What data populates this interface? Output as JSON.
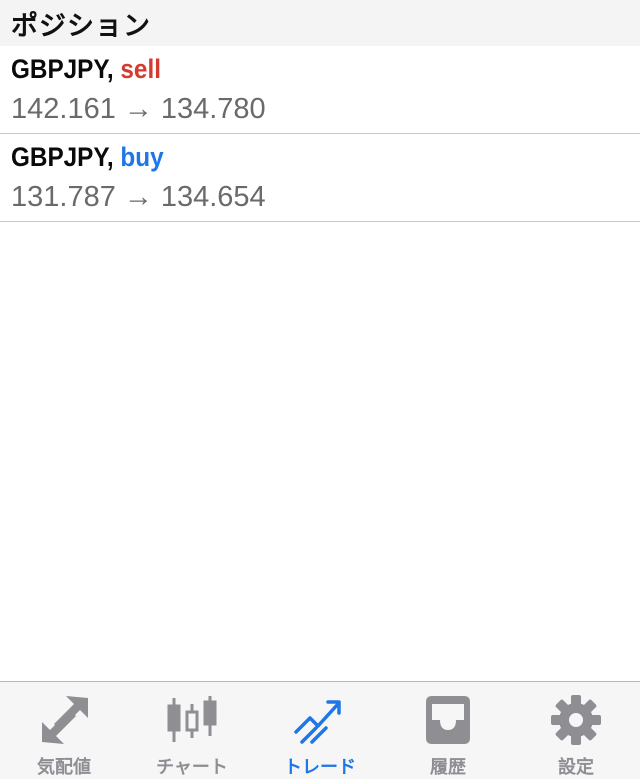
{
  "section": {
    "title": "ポジション"
  },
  "positions": [
    {
      "symbol": "GBPJPY,",
      "side": "sell",
      "open_price": "142.161",
      "arrow": "→",
      "current_price": "134.780"
    },
    {
      "symbol": "GBPJPY,",
      "side": "buy",
      "open_price": "131.787",
      "arrow": "→",
      "current_price": "134.654"
    }
  ],
  "tabs": [
    {
      "label": "気配値",
      "icon": "quotes-arrows-icon",
      "active": false
    },
    {
      "label": "チャート",
      "icon": "candlestick-chart-icon",
      "active": false
    },
    {
      "label": "トレード",
      "icon": "trade-trend-icon",
      "active": true
    },
    {
      "label": "履歴",
      "icon": "history-tray-icon",
      "active": false
    },
    {
      "label": "設定",
      "icon": "gear-icon",
      "active": false
    }
  ],
  "colors": {
    "sell": "#d43a2f",
    "buy": "#1f76e6",
    "active_tab": "#1f76e6",
    "inactive_tab": "#8e8e93"
  }
}
